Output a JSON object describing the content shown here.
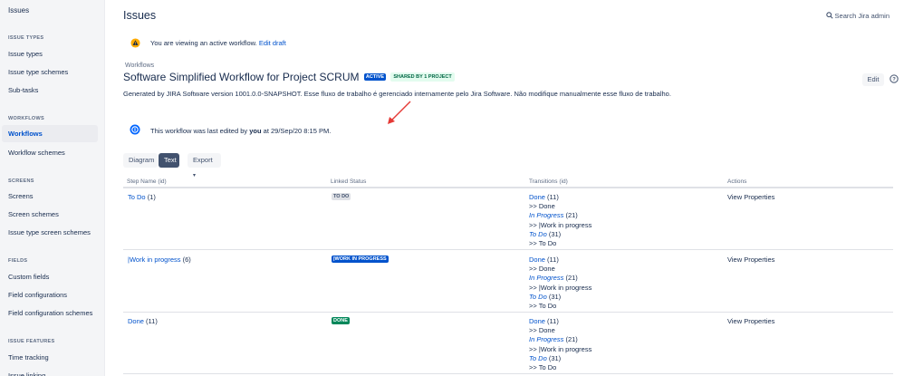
{
  "sidebar": {
    "top": "Issues",
    "sections": [
      {
        "heading": "ISSUE TYPES",
        "items": [
          "Issue types",
          "Issue type schemes",
          "Sub-tasks"
        ]
      },
      {
        "heading": "WORKFLOWS",
        "items": [
          "Workflows",
          "Workflow schemes"
        ]
      },
      {
        "heading": "SCREENS",
        "items": [
          "Screens",
          "Screen schemes",
          "Issue type screen schemes"
        ]
      },
      {
        "heading": "FIELDS",
        "items": [
          "Custom fields",
          "Field configurations",
          "Field configuration schemes"
        ]
      },
      {
        "heading": "ISSUE FEATURES",
        "items": [
          "Time tracking",
          "Issue linking"
        ]
      }
    ],
    "active_item": "Workflows"
  },
  "header": {
    "title": "Issues",
    "search": "Search Jira admin"
  },
  "draft": {
    "text": "You are viewing an active workflow.",
    "link": "Edit draft"
  },
  "breadcrumb": "Workflows",
  "workflow": {
    "title": "Software Simplified Workflow for Project SCRUM",
    "badge_active": "ACTIVE",
    "badge_shared": "SHARED BY 1 PROJECT",
    "edit_label": "Edit",
    "description": "Generated by JIRA Software version 1001.0.0-SNAPSHOT. Esse fluxo de trabalho é gerenciado internamente pelo Jira Software. Não modifique manualmente esse fluxo de trabalho."
  },
  "last_edit": {
    "prefix": "This workflow was last edited by",
    "user": "you",
    "suffix": "at 29/Sep/20 8:15 PM."
  },
  "tabs": {
    "diagram": "Diagram",
    "text": "Text",
    "export": "Export"
  },
  "table": {
    "headers": [
      "Step Name (id)",
      "Linked Status",
      "Transitions (id)",
      "Actions"
    ],
    "rows": [
      {
        "step": "To Do",
        "step_id": "(1)",
        "status": "TO DO",
        "status_kind": "todo",
        "transitions": [
          {
            "name": "Done",
            "id": "(11)",
            "target": ">> Done",
            "italic": false
          },
          {
            "name": "In Progress",
            "id": "(21)",
            "target": ">> |Work in progress",
            "italic": true
          },
          {
            "name": "To Do",
            "id": "(31)",
            "target": ">> To Do",
            "italic": true
          }
        ],
        "action": "View Properties"
      },
      {
        "step": "|Work in progress",
        "step_id": "(6)",
        "status": "|WORK IN PROGRESS",
        "status_kind": "prog",
        "transitions": [
          {
            "name": "Done",
            "id": "(11)",
            "target": ">> Done",
            "italic": false
          },
          {
            "name": "In Progress",
            "id": "(21)",
            "target": ">> |Work in progress",
            "italic": true
          },
          {
            "name": "To Do",
            "id": "(31)",
            "target": ">> To Do",
            "italic": true
          }
        ],
        "action": "View Properties"
      },
      {
        "step": "Done",
        "step_id": "(11)",
        "status": "DONE",
        "status_kind": "done",
        "transitions": [
          {
            "name": "Done",
            "id": "(11)",
            "target": ">> Done",
            "italic": false
          },
          {
            "name": "In Progress",
            "id": "(21)",
            "target": ">> |Work in progress",
            "italic": true
          },
          {
            "name": "To Do",
            "id": "(31)",
            "target": ">> To Do",
            "italic": true
          }
        ],
        "action": "View Properties"
      }
    ]
  },
  "colors": {
    "link": "#0052cc",
    "sidebar_bg": "#f4f5f7",
    "active_badge": "#0052cc",
    "done_badge": "#00875a"
  }
}
